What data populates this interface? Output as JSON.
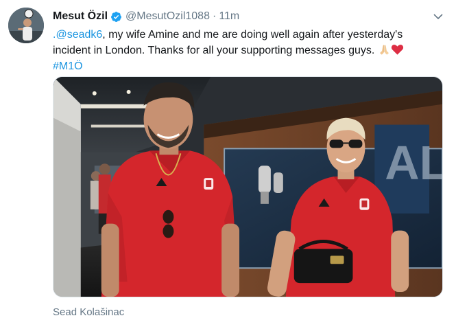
{
  "tweet": {
    "author_name": "Mesut Özil",
    "handle": "@MesutOzil1088",
    "separator": "·",
    "time": "11m",
    "text": {
      "mention": ".@seadk6",
      "body": ", my wife Amine and me are doing well again after yesterday's incident in London. Thanks for all your supporting messages guys.",
      "hashtag": "#M1Ö"
    },
    "media_caption": "Sead Kolašinac"
  },
  "icons": {
    "verified": "verified-badge-icon",
    "caret": "chevron-down-icon",
    "emoji_1": "folded-hands-emoji",
    "emoji_2": "red-heart-emoji"
  },
  "colors": {
    "link": "#1b95e0",
    "secondary_text": "#657786",
    "verified_badge": "#1da1f2",
    "jersey_red": "#d4262c"
  }
}
